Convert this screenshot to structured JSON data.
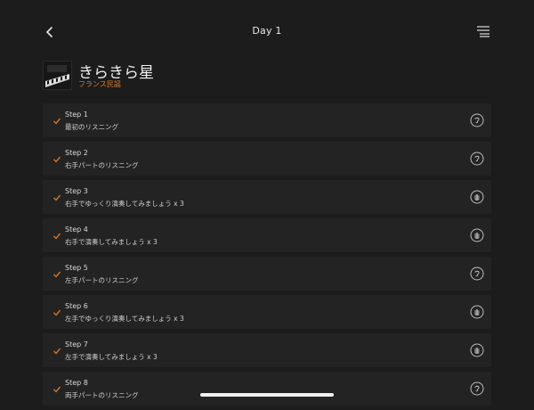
{
  "header": {
    "title": "Day 1"
  },
  "song": {
    "title": "きらきら星",
    "subtitle": "フランス民謡"
  },
  "steps": [
    {
      "title": "Step 1",
      "desc": "最初のリスニング",
      "icon": "ear-icon"
    },
    {
      "title": "Step 2",
      "desc": "右手パートのリスニング",
      "icon": "ear-icon"
    },
    {
      "title": "Step 3",
      "desc": "右手でゆっくり演奏してみましょう x 3",
      "icon": "hand-icon"
    },
    {
      "title": "Step 4",
      "desc": "右手で演奏してみましょう x 3",
      "icon": "hand-icon"
    },
    {
      "title": "Step 5",
      "desc": "左手パートのリスニング",
      "icon": "ear-icon"
    },
    {
      "title": "Step 6",
      "desc": "左手でゆっくり演奏してみましょう x 3",
      "icon": "hand-icon"
    },
    {
      "title": "Step 7",
      "desc": "左手で演奏してみましょう x 3",
      "icon": "hand-icon"
    },
    {
      "title": "Step 8",
      "desc": "両手パートのリスニング",
      "icon": "ear-icon"
    }
  ],
  "colors": {
    "accent": "#e07a2a",
    "background": "#1c1c1c",
    "row": "#232323"
  }
}
